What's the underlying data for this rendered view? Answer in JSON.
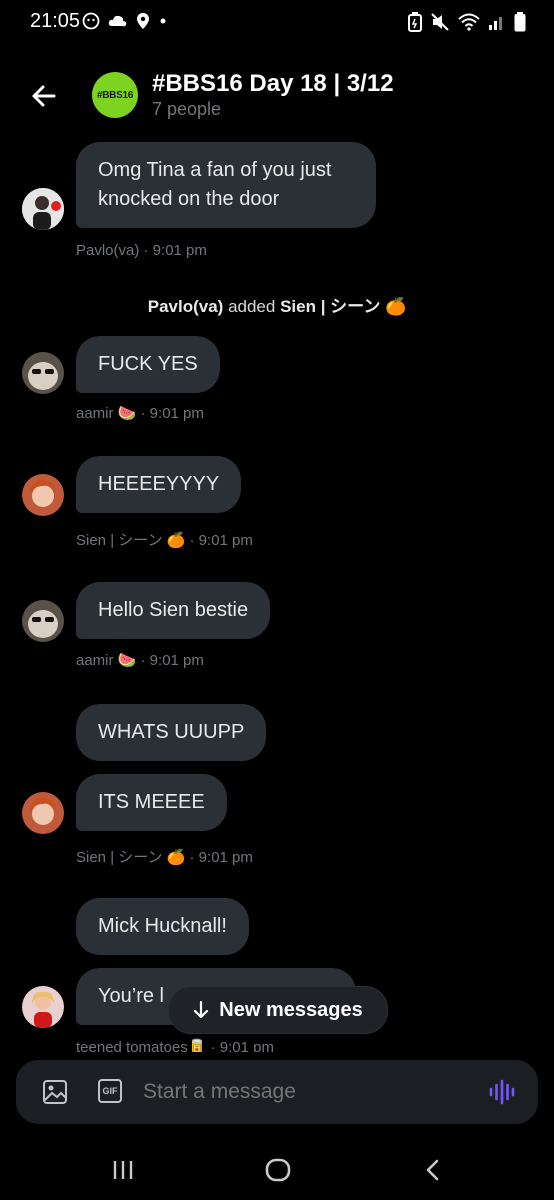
{
  "status_bar": {
    "time": "21:05",
    "left_icons": [
      "face-icon",
      "cloud-icon",
      "location-icon",
      "dot-icon"
    ],
    "right_icons": [
      "battery-saver-icon",
      "mute-icon",
      "wifi-icon",
      "signal-icon",
      "battery-icon"
    ]
  },
  "header": {
    "back_icon": "arrow-left-icon",
    "avatar_text": "#BBS16",
    "title": "#BBS16 Day 18 | 3/12",
    "subtitle": "7 people",
    "avatar_color": "#7ed321"
  },
  "messages": [
    {
      "text_line1": "Omg Tina a fan of you just",
      "text_line2": "knocked on the door",
      "meta": "Pavlo(va) · 9:01 pm"
    },
    {
      "system": {
        "actor": "Pavlo(va)",
        "verb": " added ",
        "target": "Sien | シーン 🍊"
      }
    },
    {
      "text": "FUCK YES",
      "meta": "aamir 🍉 · 9:01 pm"
    },
    {
      "text": "HEEEEYYYY",
      "meta": "Sien | シーン 🍊 · 9:01 pm"
    },
    {
      "text": "Hello Sien bestie",
      "meta": "aamir 🍉 · 9:01 pm"
    },
    {
      "text": "WHATS UUUPP"
    },
    {
      "text": "ITS MEEEE",
      "meta": "Sien | シーン 🍊 · 9:01 pm"
    },
    {
      "text": "Mick Hucknall!"
    },
    {
      "text": "You’re l",
      "meta": "teened tomatoes🥫 · 9:01 pm"
    }
  ],
  "new_messages_label": "New messages",
  "composer": {
    "placeholder": "Start a message",
    "gif_label": "GIF"
  },
  "colors": {
    "bubble": "#2a3035",
    "accent_voice": "#7856ff",
    "meta_text": "#71767b"
  }
}
